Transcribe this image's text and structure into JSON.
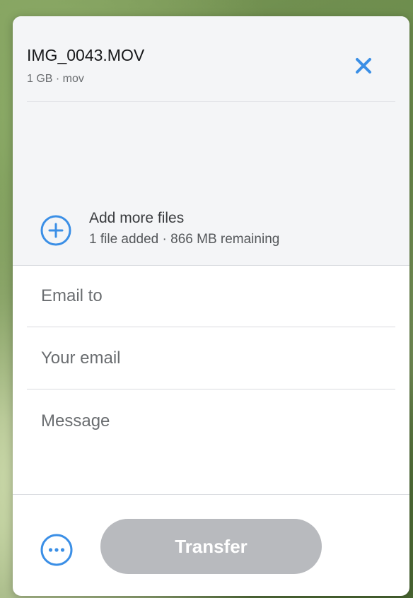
{
  "file": {
    "name": "IMG_0043.MOV",
    "meta": "1 GB · mov"
  },
  "add_files": {
    "title": "Add more files",
    "subtitle": "1 file added · 866 MB remaining"
  },
  "form": {
    "email_to_placeholder": "Email to",
    "your_email_placeholder": "Your email",
    "message_placeholder": "Message"
  },
  "actions": {
    "transfer_label": "Transfer"
  },
  "icons": {
    "remove": "close-icon",
    "add": "plus-circle-icon",
    "more": "more-options-icon"
  },
  "colors": {
    "accent": "#3b8fe6",
    "transfer_disabled": "#b8babe"
  }
}
